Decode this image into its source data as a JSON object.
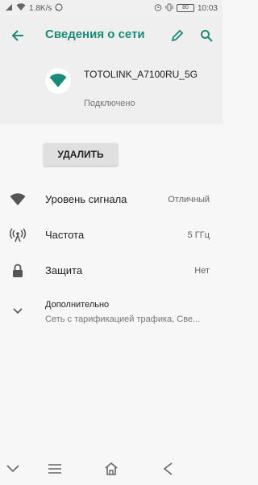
{
  "status_bar": {
    "speed": "1.8K/s",
    "battery": "80",
    "time": "10:03"
  },
  "app_bar": {
    "title": "Сведения о сети"
  },
  "network": {
    "name": "TOTOLINK_A7100RU_5G",
    "status": "Подключено"
  },
  "actions": {
    "delete_label": "УДАЛИТЬ"
  },
  "details": [
    {
      "label": "Уровень сигнала",
      "value": "Отличный"
    },
    {
      "label": "Частота",
      "value": "5 ГГц"
    },
    {
      "label": "Защита",
      "value": "Нет"
    }
  ],
  "advanced": {
    "label": "Дополнительно",
    "summary": "Сеть с тарификацией трафика, Све..."
  },
  "colors": {
    "accent": "#1b8a76",
    "icon": "#555555"
  }
}
